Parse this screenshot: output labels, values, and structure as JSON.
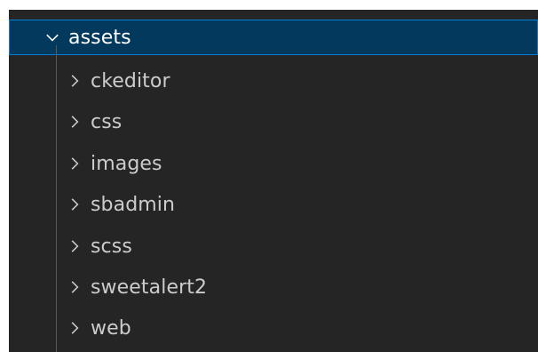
{
  "explorer": {
    "root_folder": {
      "label": "assets",
      "expanded": true,
      "icon": "chevron-down-icon"
    },
    "children": [
      {
        "label": "ckeditor",
        "icon": "chevron-right-icon"
      },
      {
        "label": "css",
        "icon": "chevron-right-icon"
      },
      {
        "label": "images",
        "icon": "chevron-right-icon"
      },
      {
        "label": "sbadmin",
        "icon": "chevron-right-icon"
      },
      {
        "label": "scss",
        "icon": "chevron-right-icon"
      },
      {
        "label": "sweetalert2",
        "icon": "chevron-right-icon"
      },
      {
        "label": "web",
        "icon": "chevron-right-icon"
      }
    ],
    "colors": {
      "background": "#252526",
      "selected_background": "#04395e",
      "selected_border": "#007fd4",
      "text": "#cccccc"
    }
  }
}
